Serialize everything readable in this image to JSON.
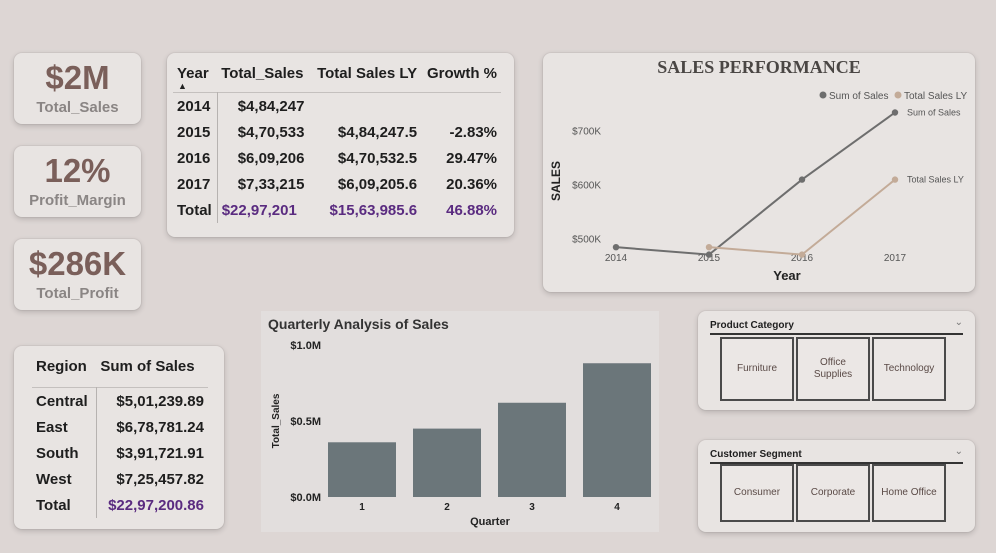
{
  "kpis": {
    "sales": {
      "value": "$2M",
      "label": "Total_Sales"
    },
    "margin": {
      "value": "12%",
      "label": "Profit_Margin"
    },
    "profit": {
      "value": "$286K",
      "label": "Total_Profit"
    }
  },
  "year_table": {
    "headers": [
      "Year",
      "Total_Sales",
      "Total Sales LY",
      "Growth %"
    ],
    "sort_icon": "sort-ascending-icon",
    "rows": [
      [
        "2014",
        "$4,84,247",
        "",
        ""
      ],
      [
        "2015",
        "$4,70,533",
        "$4,84,247.5",
        "-2.83%"
      ],
      [
        "2016",
        "$6,09,206",
        "$4,70,532.5",
        "29.47%"
      ],
      [
        "2017",
        "$7,33,215",
        "$6,09,205.6",
        "20.36%"
      ]
    ],
    "total": [
      "Total",
      "$22,97,201",
      "$15,63,985.6",
      "46.88%"
    ],
    "total_color": "#5a2b80"
  },
  "region_table": {
    "headers": [
      "Region",
      "Sum of Sales"
    ],
    "rows": [
      [
        "Central",
        "$5,01,239.89"
      ],
      [
        "East",
        "$6,78,781.24"
      ],
      [
        "South",
        "$3,91,721.91"
      ],
      [
        "West",
        "$7,25,457.82"
      ]
    ],
    "total": [
      "Total",
      "$22,97,200.86"
    ]
  },
  "line_chart": {
    "title": "SALES PERFORMANCE",
    "ylabel": "SALES",
    "xlabel": "Year",
    "legend": [
      "Sum of Sales",
      "Total Sales LY"
    ],
    "series_labels": [
      "Sum of Sales",
      "Total Sales LY"
    ],
    "colors": [
      "#6e6e6e",
      "#c3ab98"
    ]
  },
  "slicers": {
    "category": {
      "title": "Product Category",
      "options": [
        "Furniture",
        "Office Supplies",
        "Technology"
      ]
    },
    "segment": {
      "title": "Customer Segment",
      "options": [
        "Consumer",
        "Corporate",
        "Home Office"
      ]
    }
  },
  "chart_data": [
    {
      "type": "line",
      "title": "SALES PERFORMANCE",
      "xlabel": "Year",
      "ylabel": "SALES",
      "x": [
        "2014",
        "2015",
        "2016",
        "2017"
      ],
      "series": [
        {
          "name": "Sum of Sales",
          "values": [
            484247,
            470533,
            609206,
            733215
          ]
        },
        {
          "name": "Total Sales LY",
          "values": [
            null,
            484247.5,
            470532.5,
            609205.6
          ]
        }
      ],
      "yticks": [
        "$500K",
        "$600K",
        "$700K"
      ],
      "ytick_values": [
        500000,
        600000,
        700000
      ],
      "ylim": [
        455000,
        760000
      ],
      "legend_position": "top-right",
      "grid": false
    },
    {
      "type": "bar",
      "title": "Quarterly Analysis of Sales",
      "xlabel": "Quarter",
      "ylabel": "Total_Sales",
      "categories": [
        "1",
        "2",
        "3",
        "4"
      ],
      "values": [
        360000,
        450000,
        620000,
        880000
      ],
      "yticks": [
        "$0.0M",
        "$0.5M",
        "$1.0M"
      ],
      "ytick_values": [
        0,
        500000,
        1000000
      ],
      "ylim": [
        0,
        1000000
      ],
      "color": "#6b767a",
      "grid": false
    }
  ]
}
